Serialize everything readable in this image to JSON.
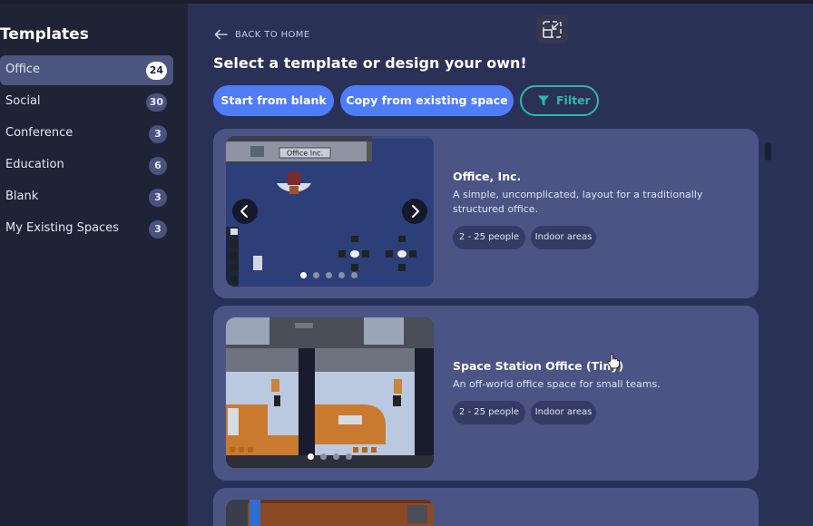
{
  "sidebar": {
    "title": "Templates",
    "items": [
      {
        "label": "Office",
        "count": "24"
      },
      {
        "label": "Social",
        "count": "30"
      },
      {
        "label": "Conference",
        "count": "3"
      },
      {
        "label": "Education",
        "count": "6"
      },
      {
        "label": "Blank",
        "count": "3"
      },
      {
        "label": "My Existing Spaces",
        "count": "3"
      }
    ]
  },
  "header": {
    "back_label": "BACK TO HOME",
    "heading": "Select a template or design your own!"
  },
  "actions": {
    "blank_label": "Start from blank",
    "copy_label": "Copy from existing space",
    "filter_label": "Filter"
  },
  "templates": [
    {
      "title": "Office, Inc.",
      "description": "A simple, uncomplicated, layout for a traditionally structured office.",
      "tags": [
        "2 - 25 people",
        "Indoor areas"
      ],
      "preview_sign": "Office Inc.",
      "slides": 5,
      "active_slide": 1
    },
    {
      "title": "Space Station Office (Tiny)",
      "description": "An off-world office space for small teams.",
      "tags": [
        "2 - 25 people",
        "Indoor areas"
      ],
      "slides": 4,
      "active_slide": 1
    }
  ],
  "icons": {
    "back": "arrow-left-icon",
    "minimize": "minimize-icon",
    "filter": "filter-icon",
    "prev": "chevron-left-icon",
    "next": "chevron-right-icon"
  },
  "colors": {
    "accent": "#4f7df7",
    "filter": "#2fb7a8",
    "card": "#4b5485",
    "sidebar_active": "#4d5680"
  }
}
